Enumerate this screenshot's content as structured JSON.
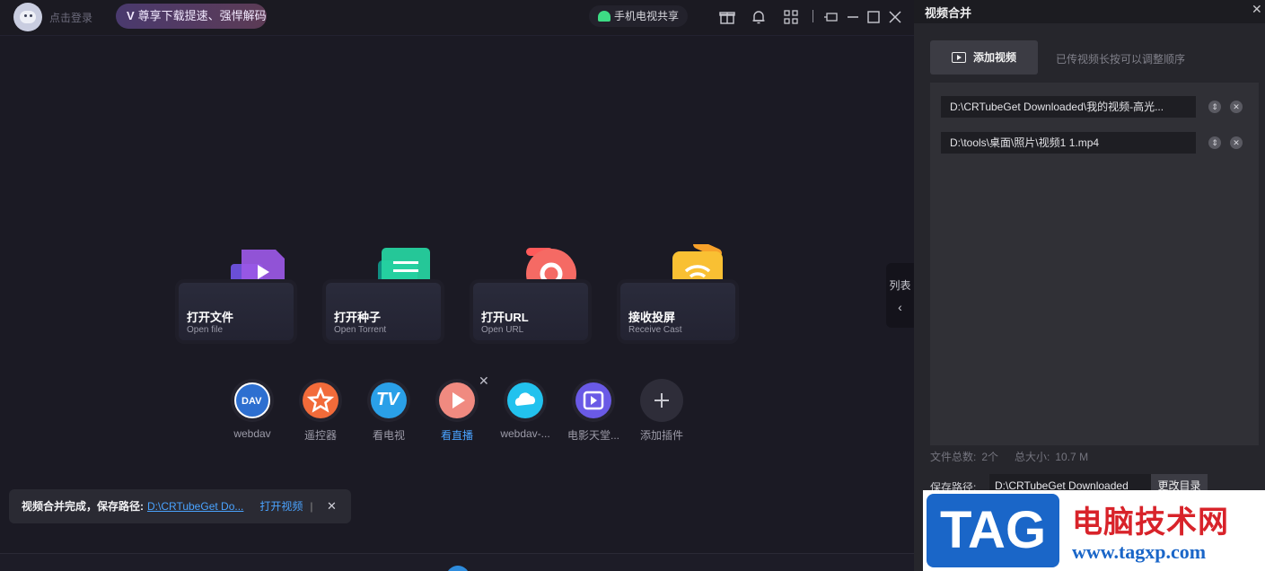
{
  "titlebar": {
    "login_text": "点击登录",
    "vip_badge": "V",
    "vip_text": "尊享下载提速、强悍解码",
    "share_text": "手机电视共享"
  },
  "cards": [
    {
      "title": "打开文件",
      "subtitle": "Open file"
    },
    {
      "title": "打开种子",
      "subtitle": "Open Torrent"
    },
    {
      "title": "打开URL",
      "subtitle": "Open URL"
    },
    {
      "title": "接收投屏",
      "subtitle": "Receive Cast"
    }
  ],
  "plugins": [
    {
      "label": "webdav",
      "icon": "webdav-icon",
      "inner_text": "DAV"
    },
    {
      "label": "遥控器",
      "icon": "remote-star-icon"
    },
    {
      "label": "看电视",
      "icon": "tv-icon",
      "inner_text": "TV"
    },
    {
      "label": "看直播",
      "icon": "live-play-icon"
    },
    {
      "label": "webdav-...",
      "icon": "cloud-puzzle-icon"
    },
    {
      "label": "电影天堂...",
      "icon": "movie-play-icon"
    },
    {
      "label": "添加插件",
      "icon": "add-plugin-icon"
    }
  ],
  "list_tab": {
    "label": "列表"
  },
  "toast": {
    "message": "视频合并完成，保存路径:",
    "path": "D:\\CRTubeGet Do...",
    "open_video": "打开视频",
    "separator": "|"
  },
  "panel": {
    "title": "视频合并",
    "add_video": "添加视频",
    "hint": "已传视频长按可以调整顺序",
    "files": [
      "D:\\CRTubeGet Downloaded\\我的视频-高光...",
      "D:\\tools\\桌面\\照片\\视频1 1.mp4"
    ],
    "stats": {
      "count_label": "文件总数:",
      "count_value": "2个",
      "size_label": "总大小:",
      "size_value": "10.7 M"
    },
    "save_label": "保存路径:",
    "save_path": "D:\\CRTubeGet Downloaded",
    "change_dir": "更改目录"
  },
  "watermark": {
    "tag": "TAG",
    "site_name": "电脑技术网",
    "url": "www.tagxp.com"
  },
  "colors": {
    "accent": "#4aa3ff",
    "vip_gradient_start": "#4a3a6e",
    "vip_gradient_end": "#5c3b55"
  }
}
